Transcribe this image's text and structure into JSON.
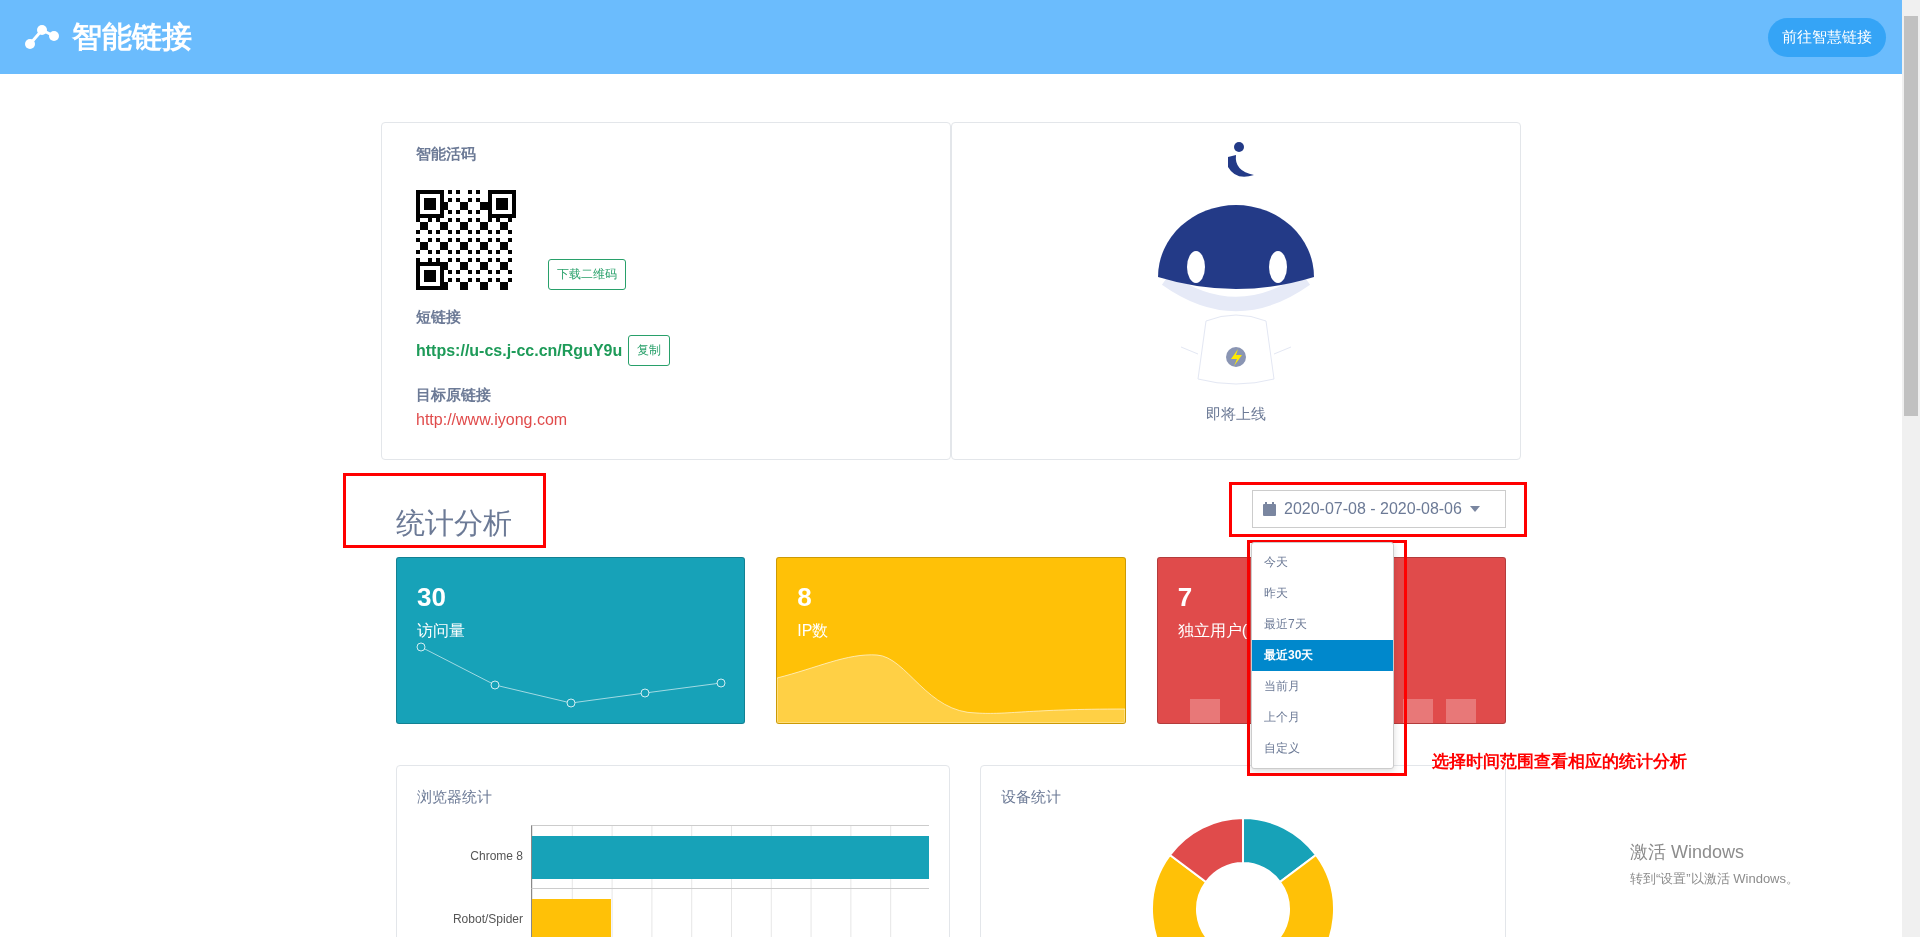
{
  "header": {
    "title": "智能链接",
    "button": "前往智慧链接"
  },
  "qr_card": {
    "title": "智能活码",
    "download_button": "下载二维码",
    "short_link_label": "短链接",
    "short_link": "https://u-cs.j-cc.cn/RguY9u",
    "copy_button": "复制",
    "target_label": "目标原链接",
    "target_link": "http://www.iyong.com"
  },
  "robot_card": {
    "caption": "即将上线"
  },
  "stats": {
    "title": "统计分析",
    "date_range": "2020-07-08 - 2020-08-06",
    "range_options": [
      {
        "label": "今天",
        "selected": false
      },
      {
        "label": "昨天",
        "selected": false
      },
      {
        "label": "最近7天",
        "selected": false
      },
      {
        "label": "最近30天",
        "selected": true
      },
      {
        "label": "当前月",
        "selected": false
      },
      {
        "label": "上个月",
        "selected": false
      },
      {
        "label": "自定义",
        "selected": false
      }
    ],
    "annotation": "选择时间范围查看相应的统计分析",
    "cards": [
      {
        "kind": "line",
        "value": "30",
        "label": "访问量",
        "color": "#17a2b8"
      },
      {
        "kind": "area",
        "value": "8",
        "label": "IP数",
        "color": "#ffc107"
      },
      {
        "kind": "bars",
        "value": "7",
        "label": "独立用户(",
        "color": "#e04b4b"
      }
    ]
  },
  "browser_chart": {
    "title": "浏览器统计",
    "bars": [
      {
        "label": "Chrome 8",
        "level": 1,
        "color": "#17a2b8"
      },
      {
        "label": "Robot/Spider",
        "level": 0.2,
        "color": "#ffc107"
      }
    ]
  },
  "device_chart": {
    "title": "设备统计"
  },
  "os_notice": {
    "title": "激活 Windows",
    "text": "转到“设置”以激活 Windows。"
  }
}
